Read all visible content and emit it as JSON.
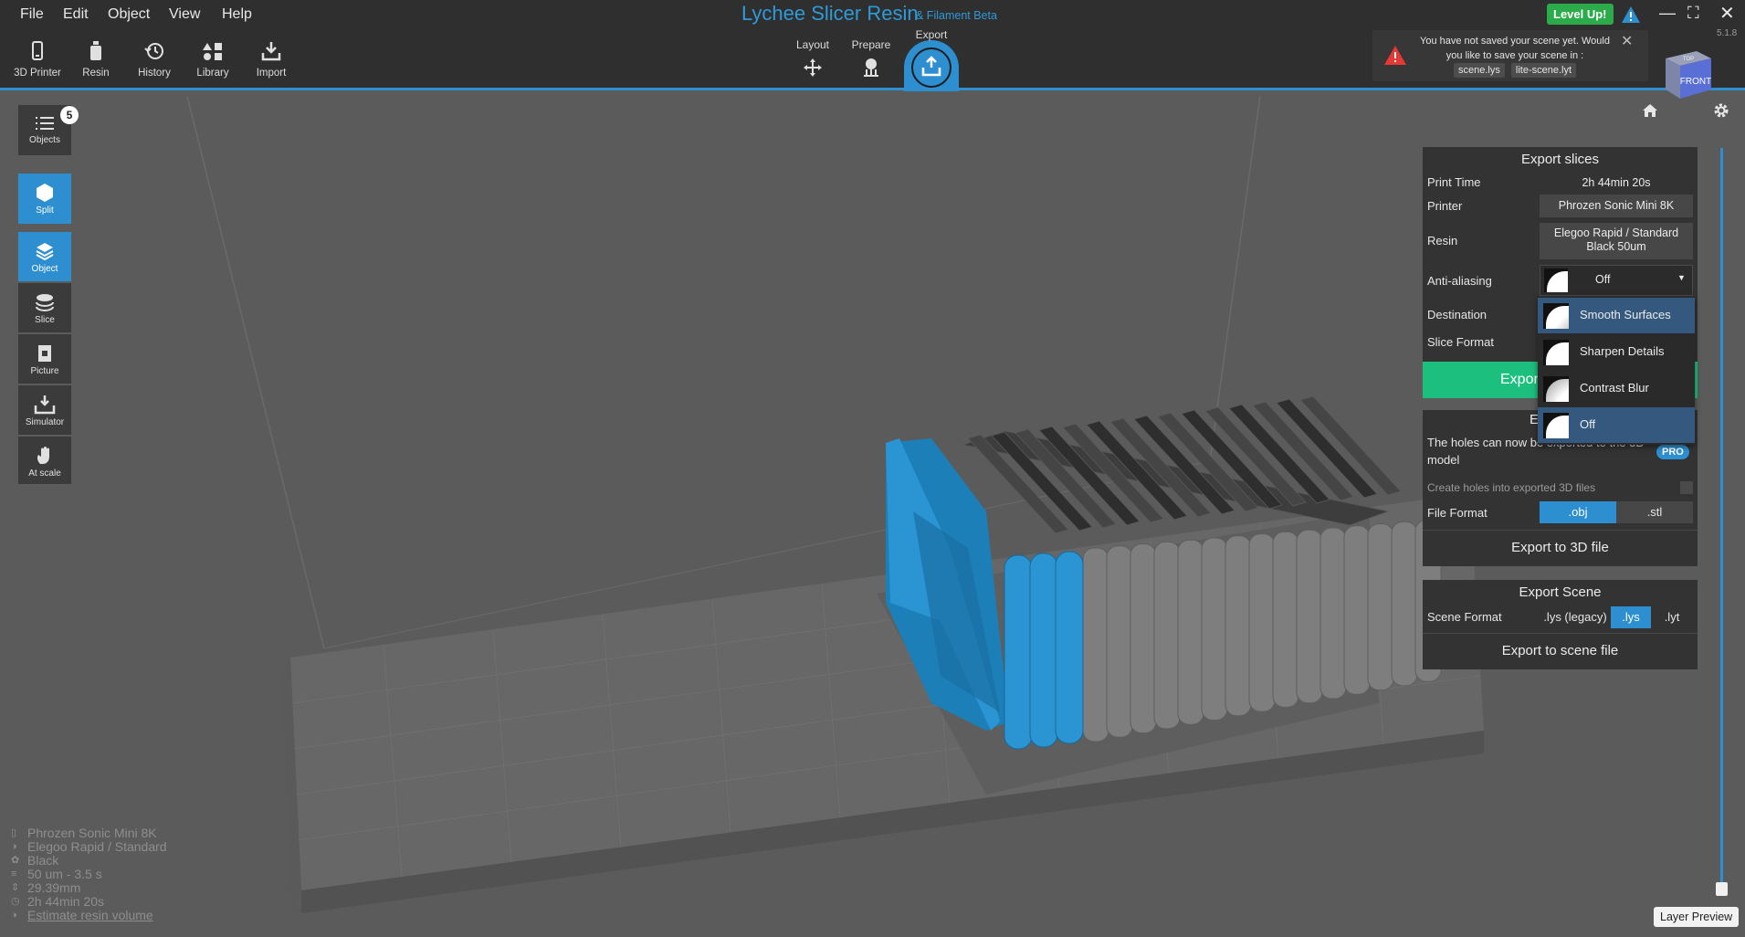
{
  "menu": [
    "File",
    "Edit",
    "Object",
    "View",
    "Help"
  ],
  "toolbar": [
    {
      "label": "3D Printer",
      "icon": "phone-printer-icon"
    },
    {
      "label": "Resin",
      "icon": "resin-bottle-icon"
    },
    {
      "label": "History",
      "icon": "history-icon"
    },
    {
      "label": "Library",
      "icon": "library-icon"
    },
    {
      "label": "Import",
      "icon": "import-icon"
    }
  ],
  "app": {
    "title": "Lychee Slicer Resin",
    "subtitle": "& Filament Beta",
    "version": "5.1.8"
  },
  "modes": {
    "layout": "Layout",
    "prepare": "Prepare",
    "export": "Export",
    "active": "Export"
  },
  "levelup": "Level Up!",
  "notification": {
    "text": "You have not saved your scene yet. Would you like to save your scene in :",
    "option1": "scene.lys",
    "option2": "lite-scene.lyt"
  },
  "viewcube": {
    "front": "FRONT",
    "top": "TOP"
  },
  "left_toolbar": {
    "objects": "Objects",
    "objects_count": "5",
    "split": "Split",
    "object": "Object",
    "slice": "Slice",
    "picture": "Picture",
    "simulator": "Simulator",
    "at_scale": "At scale"
  },
  "export_slices": {
    "title": "Export slices",
    "print_time_label": "Print Time",
    "print_time": "2h 44min 20s",
    "printer_label": "Printer",
    "printer": "Phrozen Sonic Mini 8K",
    "resin_label": "Resin",
    "resin_line1": "Elegoo Rapid / Standard",
    "resin_line2": "Black 50um",
    "aa_label": "Anti-aliasing",
    "aa_value": "Off",
    "destination_label": "Destination",
    "slice_format_label": "Slice Format",
    "export_button": "Export"
  },
  "aa_options": [
    {
      "label": "Smooth Surfaces",
      "highlighted": true
    },
    {
      "label": "Sharpen Details",
      "highlighted": false
    },
    {
      "label": "Contrast Blur",
      "highlighted": false
    },
    {
      "label": "Off",
      "highlighted": true
    }
  ],
  "export_3d": {
    "title": "E",
    "text_line1": "The holes can now be exported to the 3D",
    "text_line2": "model",
    "pro_badge": "PRO",
    "create_holes_label": "Create holes into exported 3D files",
    "create_holes_checked": false,
    "file_format_label": "File Format",
    "formats": [
      ".obj",
      ".stl"
    ],
    "selected": ".obj",
    "button": "Export to 3D file"
  },
  "export_scene": {
    "title": "Export Scene",
    "format_label": "Scene Format",
    "formats": [
      ".lys (legacy)",
      ".lys",
      ".lyt"
    ],
    "selected": ".lys",
    "button": "Export to scene file"
  },
  "layer_preview": "Layer Preview",
  "info": {
    "printer": "Phrozen Sonic Mini 8K",
    "resin_line1": "Elegoo Rapid / Standard",
    "resin_line2": "Black",
    "layer": "50 um - 3.5 s",
    "height": "29.39mm",
    "time": "2h 44min 20s",
    "estimate": "Estimate resin volume"
  },
  "colors": {
    "accent": "#2d8fd0",
    "levelup": "#2bab4a",
    "export_button": "#1dbf7e",
    "selected_model": "#1f86c0"
  }
}
